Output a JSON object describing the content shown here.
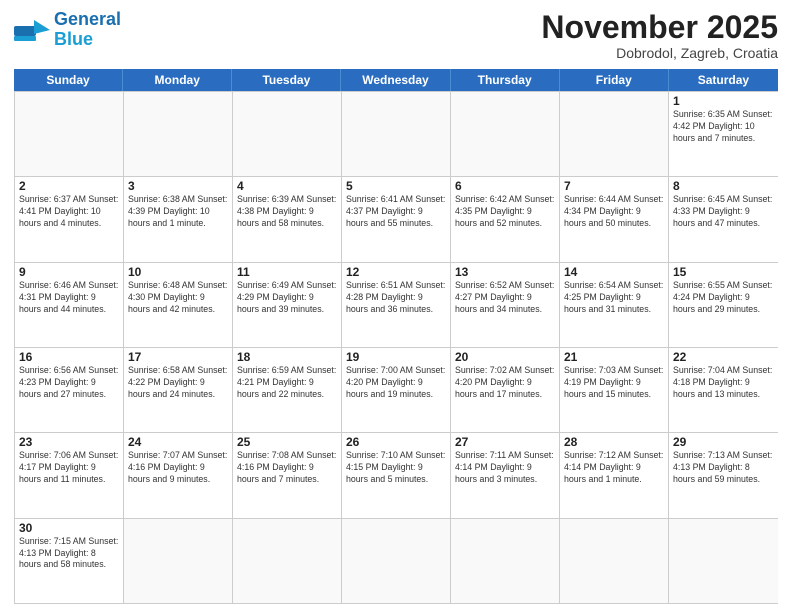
{
  "logo": {
    "text_general": "General",
    "text_blue": "Blue"
  },
  "title": {
    "month_year": "November 2025",
    "location": "Dobrodol, Zagreb, Croatia"
  },
  "weekdays": [
    "Sunday",
    "Monday",
    "Tuesday",
    "Wednesday",
    "Thursday",
    "Friday",
    "Saturday"
  ],
  "rows": [
    [
      {
        "day": "",
        "info": ""
      },
      {
        "day": "",
        "info": ""
      },
      {
        "day": "",
        "info": ""
      },
      {
        "day": "",
        "info": ""
      },
      {
        "day": "",
        "info": ""
      },
      {
        "day": "",
        "info": ""
      },
      {
        "day": "1",
        "info": "Sunrise: 6:35 AM\nSunset: 4:42 PM\nDaylight: 10 hours and 7 minutes."
      }
    ],
    [
      {
        "day": "2",
        "info": "Sunrise: 6:37 AM\nSunset: 4:41 PM\nDaylight: 10 hours and 4 minutes."
      },
      {
        "day": "3",
        "info": "Sunrise: 6:38 AM\nSunset: 4:39 PM\nDaylight: 10 hours and 1 minute."
      },
      {
        "day": "4",
        "info": "Sunrise: 6:39 AM\nSunset: 4:38 PM\nDaylight: 9 hours and 58 minutes."
      },
      {
        "day": "5",
        "info": "Sunrise: 6:41 AM\nSunset: 4:37 PM\nDaylight: 9 hours and 55 minutes."
      },
      {
        "day": "6",
        "info": "Sunrise: 6:42 AM\nSunset: 4:35 PM\nDaylight: 9 hours and 52 minutes."
      },
      {
        "day": "7",
        "info": "Sunrise: 6:44 AM\nSunset: 4:34 PM\nDaylight: 9 hours and 50 minutes."
      },
      {
        "day": "8",
        "info": "Sunrise: 6:45 AM\nSunset: 4:33 PM\nDaylight: 9 hours and 47 minutes."
      }
    ],
    [
      {
        "day": "9",
        "info": "Sunrise: 6:46 AM\nSunset: 4:31 PM\nDaylight: 9 hours and 44 minutes."
      },
      {
        "day": "10",
        "info": "Sunrise: 6:48 AM\nSunset: 4:30 PM\nDaylight: 9 hours and 42 minutes."
      },
      {
        "day": "11",
        "info": "Sunrise: 6:49 AM\nSunset: 4:29 PM\nDaylight: 9 hours and 39 minutes."
      },
      {
        "day": "12",
        "info": "Sunrise: 6:51 AM\nSunset: 4:28 PM\nDaylight: 9 hours and 36 minutes."
      },
      {
        "day": "13",
        "info": "Sunrise: 6:52 AM\nSunset: 4:27 PM\nDaylight: 9 hours and 34 minutes."
      },
      {
        "day": "14",
        "info": "Sunrise: 6:54 AM\nSunset: 4:25 PM\nDaylight: 9 hours and 31 minutes."
      },
      {
        "day": "15",
        "info": "Sunrise: 6:55 AM\nSunset: 4:24 PM\nDaylight: 9 hours and 29 minutes."
      }
    ],
    [
      {
        "day": "16",
        "info": "Sunrise: 6:56 AM\nSunset: 4:23 PM\nDaylight: 9 hours and 27 minutes."
      },
      {
        "day": "17",
        "info": "Sunrise: 6:58 AM\nSunset: 4:22 PM\nDaylight: 9 hours and 24 minutes."
      },
      {
        "day": "18",
        "info": "Sunrise: 6:59 AM\nSunset: 4:21 PM\nDaylight: 9 hours and 22 minutes."
      },
      {
        "day": "19",
        "info": "Sunrise: 7:00 AM\nSunset: 4:20 PM\nDaylight: 9 hours and 19 minutes."
      },
      {
        "day": "20",
        "info": "Sunrise: 7:02 AM\nSunset: 4:20 PM\nDaylight: 9 hours and 17 minutes."
      },
      {
        "day": "21",
        "info": "Sunrise: 7:03 AM\nSunset: 4:19 PM\nDaylight: 9 hours and 15 minutes."
      },
      {
        "day": "22",
        "info": "Sunrise: 7:04 AM\nSunset: 4:18 PM\nDaylight: 9 hours and 13 minutes."
      }
    ],
    [
      {
        "day": "23",
        "info": "Sunrise: 7:06 AM\nSunset: 4:17 PM\nDaylight: 9 hours and 11 minutes."
      },
      {
        "day": "24",
        "info": "Sunrise: 7:07 AM\nSunset: 4:16 PM\nDaylight: 9 hours and 9 minutes."
      },
      {
        "day": "25",
        "info": "Sunrise: 7:08 AM\nSunset: 4:16 PM\nDaylight: 9 hours and 7 minutes."
      },
      {
        "day": "26",
        "info": "Sunrise: 7:10 AM\nSunset: 4:15 PM\nDaylight: 9 hours and 5 minutes."
      },
      {
        "day": "27",
        "info": "Sunrise: 7:11 AM\nSunset: 4:14 PM\nDaylight: 9 hours and 3 minutes."
      },
      {
        "day": "28",
        "info": "Sunrise: 7:12 AM\nSunset: 4:14 PM\nDaylight: 9 hours and 1 minute."
      },
      {
        "day": "29",
        "info": "Sunrise: 7:13 AM\nSunset: 4:13 PM\nDaylight: 8 hours and 59 minutes."
      }
    ],
    [
      {
        "day": "30",
        "info": "Sunrise: 7:15 AM\nSunset: 4:13 PM\nDaylight: 8 hours and 58 minutes."
      },
      {
        "day": "",
        "info": ""
      },
      {
        "day": "",
        "info": ""
      },
      {
        "day": "",
        "info": ""
      },
      {
        "day": "",
        "info": ""
      },
      {
        "day": "",
        "info": ""
      },
      {
        "day": "",
        "info": ""
      }
    ]
  ]
}
